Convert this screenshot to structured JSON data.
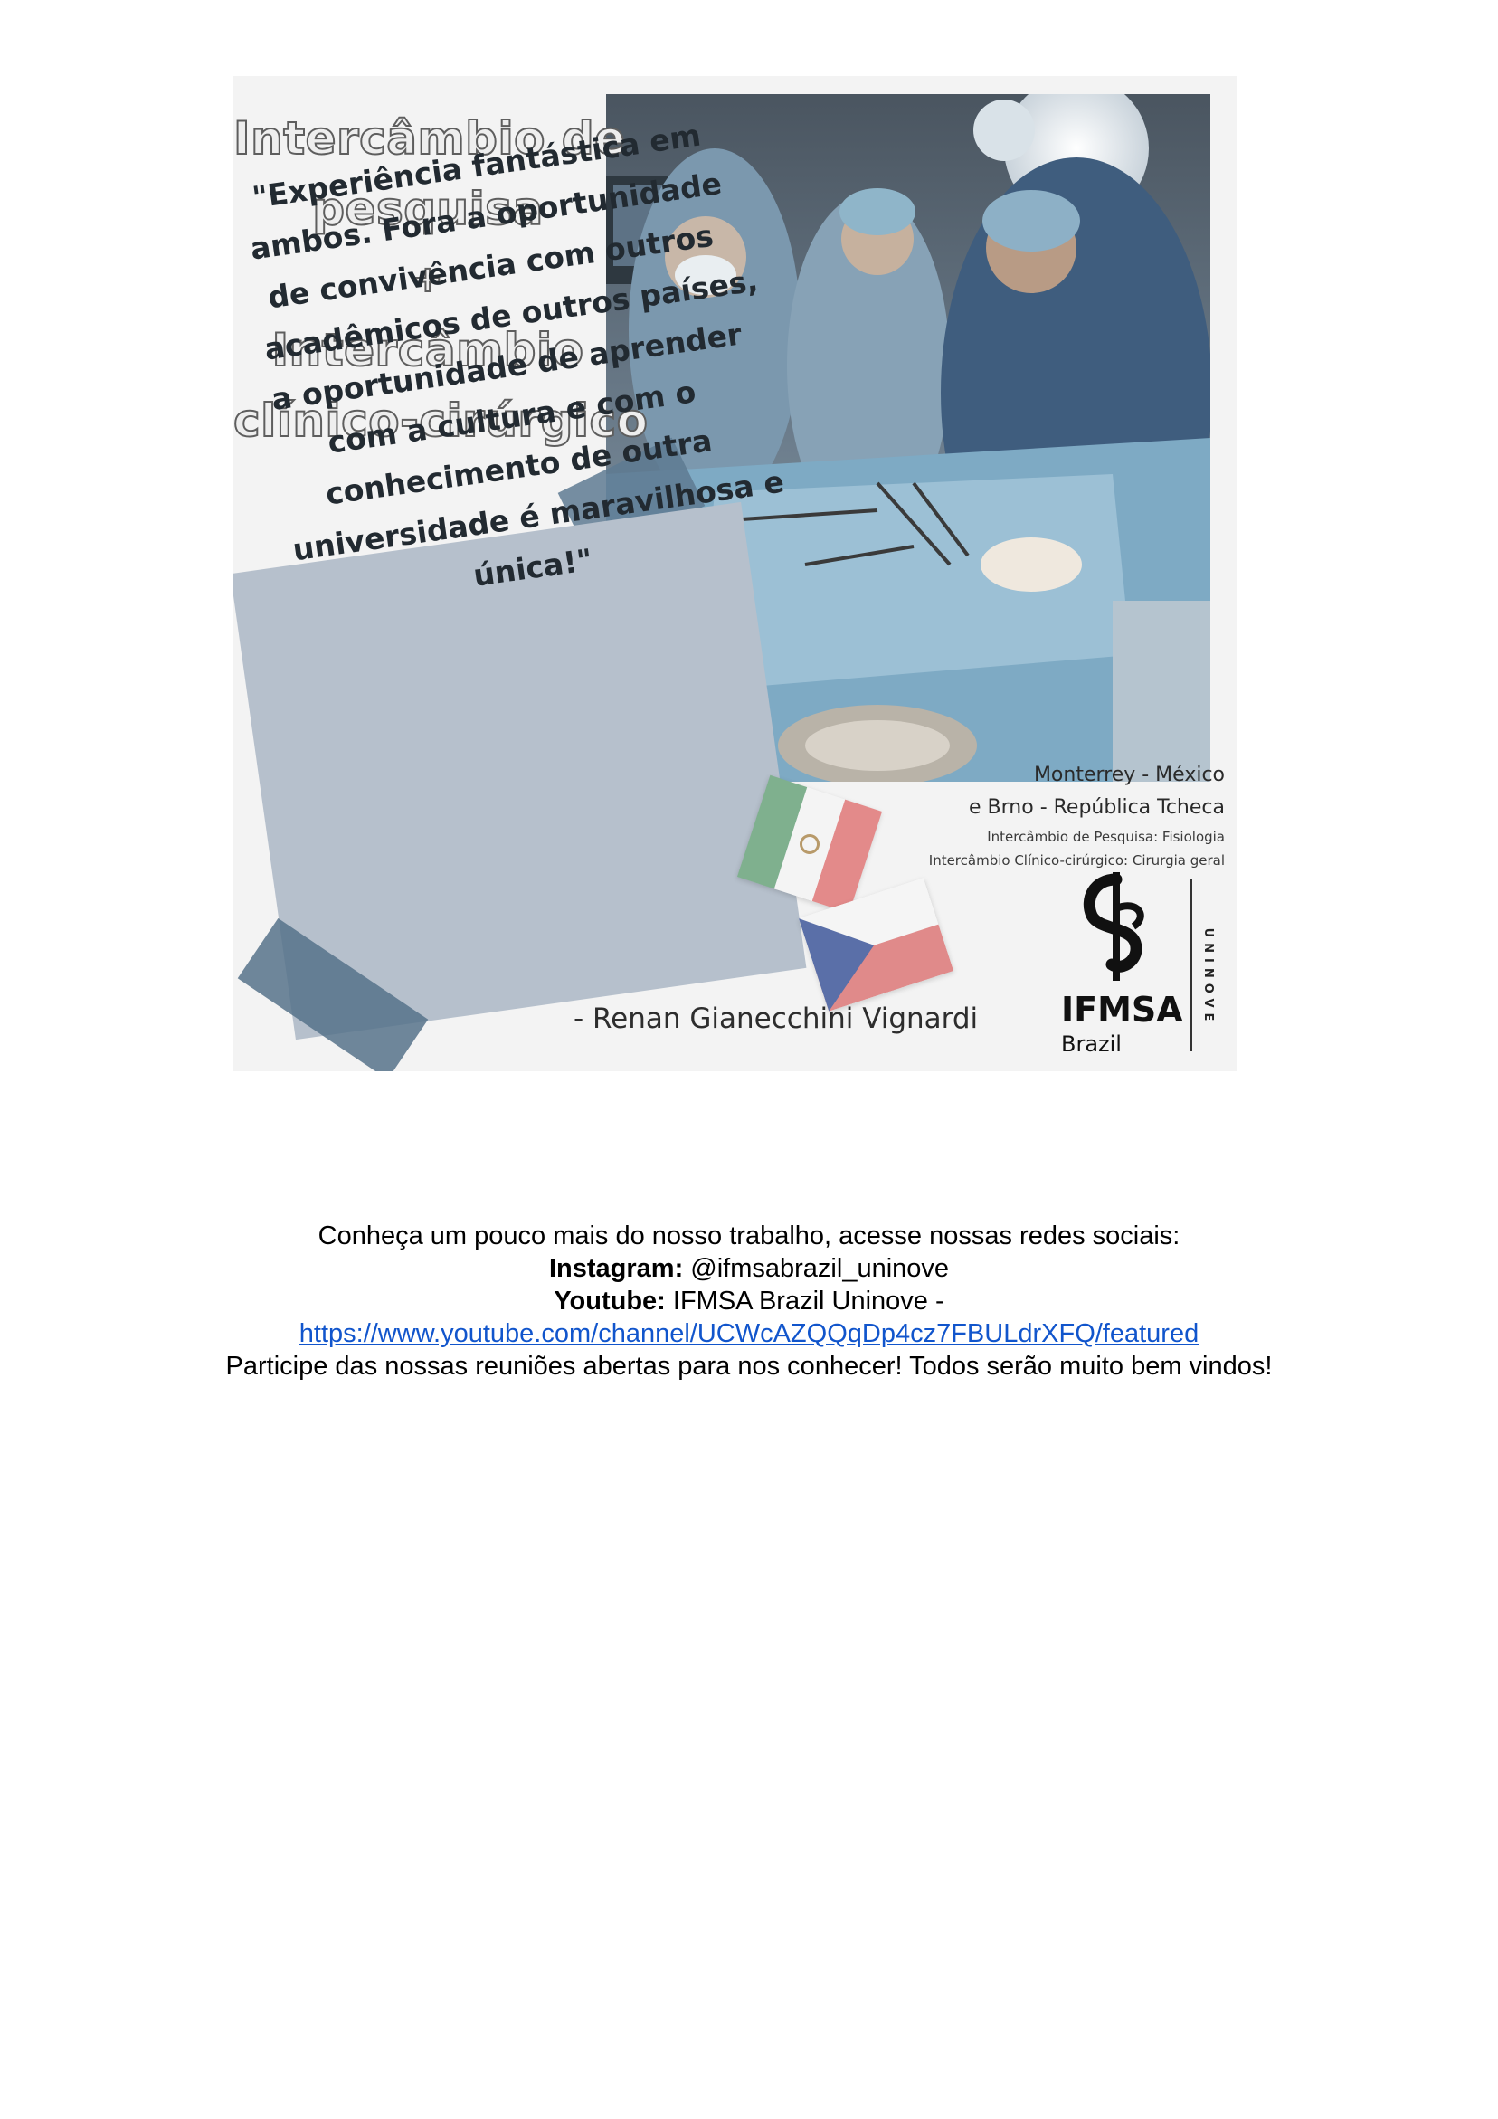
{
  "poster": {
    "heading": {
      "line1": "Intercâmbio de",
      "line2": "pesquisa",
      "plus": "+",
      "line3": "Intercâmbio",
      "line4": "clínico-cirúrgico"
    },
    "quote_lines": [
      "\"Experiência fantástica em",
      "ambos. Fora a oportunidade",
      "de convivência com outros",
      "acadêmicos de outros países,",
      "a oportunidade de aprender",
      "com a cultura e com o",
      "conhecimento de outra",
      "universidade é maravilhosa e",
      "única!\""
    ],
    "author": "- Renan Gianecchini Vignardi",
    "location_line1": "Monterrey - México",
    "location_line2": "e Brno - República Tcheca",
    "program_line1": "Intercâmbio de Pesquisa: Fisiologia",
    "program_line2": "Intercâmbio Clínico-cirúrgico: Cirurgia geral",
    "logo_text": "IFMSA",
    "logo_sub": "Brazil",
    "logo_side": "UNINOVE",
    "colors": {
      "card": "#b6c0cc",
      "tape": "#5e7a92",
      "mexico_green": "#7fb08e",
      "mexico_red": "#e38a8a",
      "czech_blue": "#5a6fa8",
      "czech_red": "#e08a8a"
    }
  },
  "info": {
    "intro": "Conheça um pouco mais do nosso trabalho, acesse nossas redes sociais:",
    "instagram_label": "Instagram:",
    "instagram_value": " @ifmsabrazil_uninove",
    "youtube_label": "Youtube:",
    "youtube_value": " IFMSA Brazil Uninove -",
    "youtube_url": "https://www.youtube.com/channel/UCWcAZQQqDp4cz7FBULdrXFQ/featured",
    "closing": "Participe das nossas reuniões abertas para nos conhecer! Todos serão muito bem vindos!"
  }
}
